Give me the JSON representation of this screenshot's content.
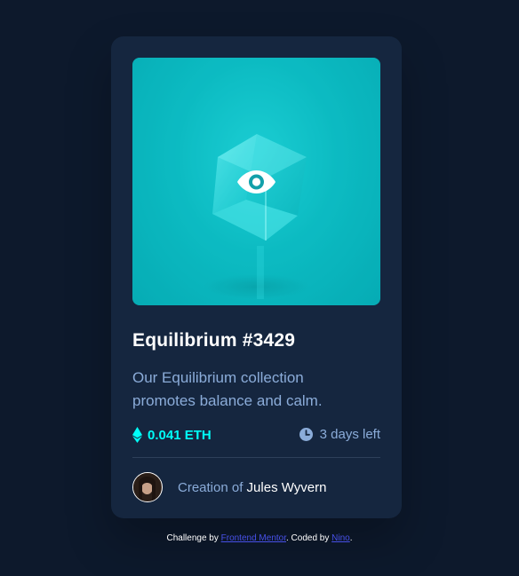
{
  "card": {
    "image": {
      "alt_icon": "eye-icon",
      "overlay_color": "#00fff8"
    },
    "title": "Equilibrium #3429",
    "description": "Our Equilibrium collection promotes balance and calm.",
    "price": {
      "icon": "ethereum-icon",
      "value": "0.041 ETH"
    },
    "time": {
      "icon": "clock-icon",
      "value": "3 days left"
    },
    "creator": {
      "prefix": "Creation of",
      "name": "Jules Wyvern"
    }
  },
  "attribution": {
    "prefix": "Challenge by",
    "challenge_link": "Frontend Mentor",
    "middle": ". Coded by",
    "author_link": "Nino",
    "suffix": "."
  },
  "colors": {
    "background": "#0d192c",
    "card": "#15263f",
    "cyan": "#00fff8",
    "soft_blue": "#8bacd9",
    "link": "#4750e8"
  }
}
